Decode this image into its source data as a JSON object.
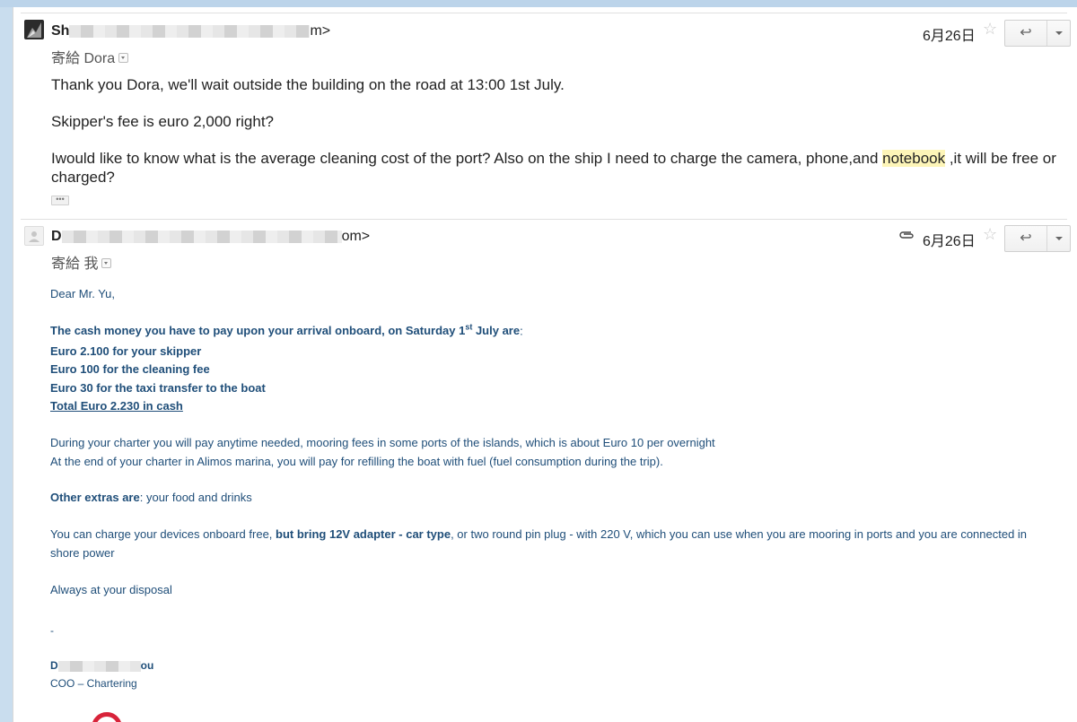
{
  "messages": [
    {
      "sender_start": "Sh",
      "sender_end": "m>",
      "to_label": "寄給",
      "to_name": "Dora",
      "date": "6月26日",
      "body": {
        "p1": "Thank you Dora, we'll wait outside the building on the road at 13:00 1st July.",
        "p2": "Skipper's fee is euro 2,000 right?",
        "p3_before": "Iwould like to know what is the average cleaning cost of the port? Also on the ship I need to charge the camera, phone,and ",
        "p3_highlight": "notebook",
        "p3_after": " ,it will be free or charged?"
      },
      "ellipsis": "•••"
    },
    {
      "sender_start": "D",
      "sender_end": "om>",
      "to_label": "寄給",
      "to_name": "我",
      "date": "6月26日",
      "body": {
        "greeting": "Dear Mr. Yu,",
        "cash_before": "The cash money you have to pay upon your arrival onboard, on Saturday 1",
        "cash_sup": "st",
        "cash_after": " July are",
        "cash_colon": ":",
        "line_skipper": "Euro 2.100 for your skipper",
        "line_cleaning": "Euro 100 for the cleaning fee",
        "line_taxi": "Euro 30 for the taxi transfer to the boat",
        "line_total": "Total Euro 2.230 in cash",
        "charter1": "During your charter you will pay anytime needed, mooring fees in some ports of the islands, which is about Euro 10 per overnight",
        "charter2": "At the end of your charter in Alimos marina, you will pay for refilling the boat with fuel  (fuel  consumption during the trip).",
        "extras_bold": "Other extras are",
        "extras_rest": ": your food and drinks",
        "devices_a": "You can charge your devices onboard free, ",
        "devices_bold": "but bring 12V adapter - car type",
        "devices_b": ", or two round pin plug  - with 220 V, which you can use when you are mooring in ports and you are connected in",
        "devices_c": "shore power",
        "closing": "Always at your disposal",
        "dash": "-",
        "sig_start": "D",
        "sig_end": "ou",
        "sig_title": "COO – Chartering"
      }
    }
  ],
  "colors": {
    "body_blue": "#1f4e79",
    "highlight": "#fdf5b8"
  },
  "icons": [
    "star-icon",
    "reply-icon",
    "more-actions-icon",
    "attachment-icon",
    "avatar"
  ]
}
